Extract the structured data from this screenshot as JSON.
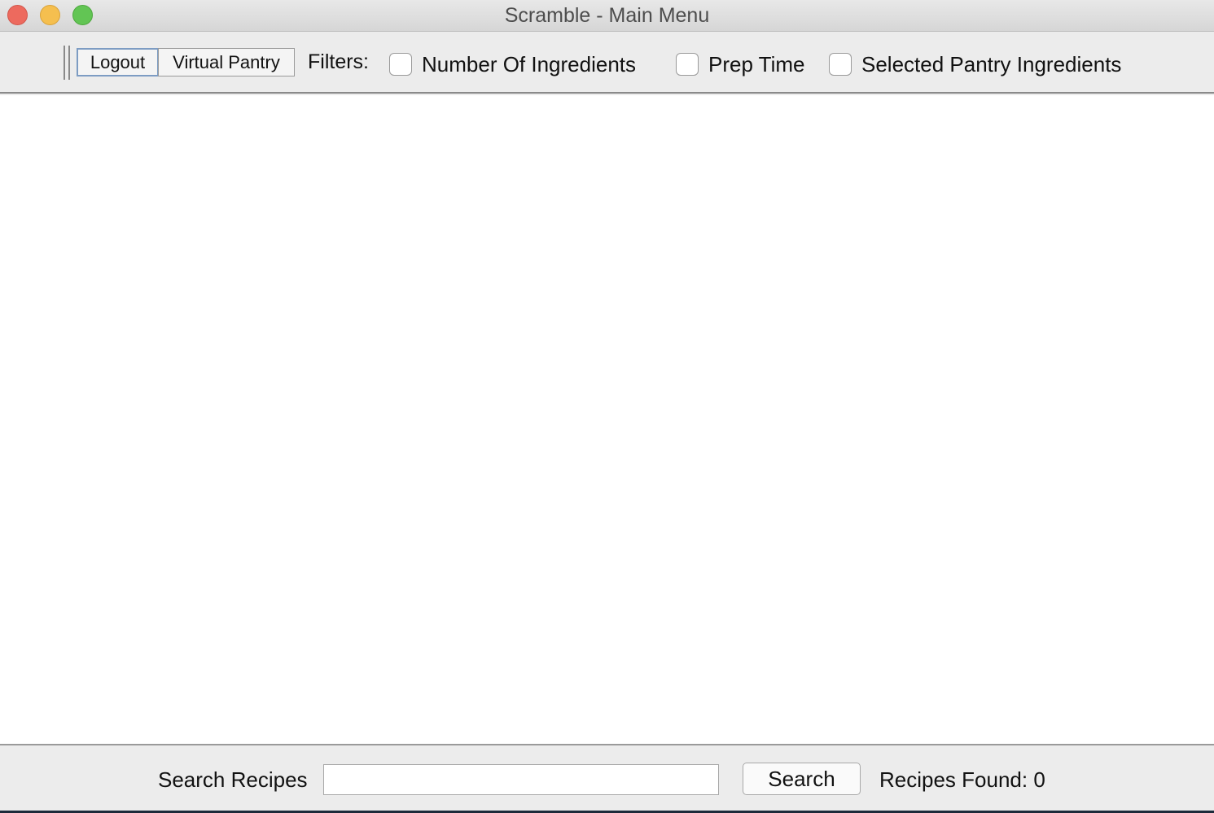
{
  "window": {
    "title": "Scramble - Main Menu"
  },
  "toolbar": {
    "logout_label": "Logout",
    "virtual_pantry_label": "Virtual Pantry",
    "filters_label": "Filters:",
    "filters": [
      {
        "label": "Number Of Ingredients",
        "checked": false
      },
      {
        "label": "Prep Time",
        "checked": false
      },
      {
        "label": "Selected Pantry Ingredients",
        "checked": false
      }
    ]
  },
  "bottom": {
    "search_label": "Search Recipes",
    "search_value": "",
    "search_button_label": "Search",
    "recipes_found": "Recipes Found: 0"
  },
  "colors": {
    "close": "#ed6a5e",
    "minimize": "#f5bf4f",
    "maximize": "#62c554",
    "focus_border": "#7d9cc3"
  }
}
